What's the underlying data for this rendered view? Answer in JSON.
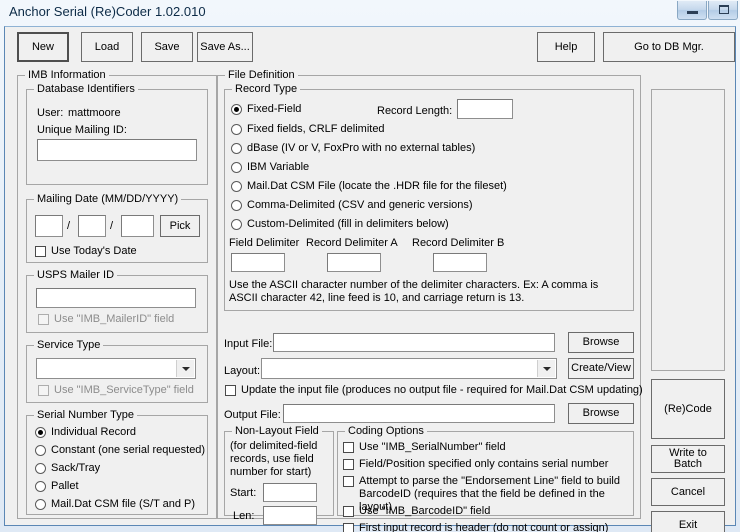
{
  "window": {
    "title": "Anchor Serial (Re)Coder 1.02.010",
    "minimize_label": "Minimize",
    "maximize_label": "Maximize"
  },
  "toolbar": {
    "new_label": "New",
    "load_label": "Load",
    "save_label": "Save",
    "save_as_label": "Save As...",
    "help_label": "Help",
    "db_mgr_label": "Go to DB Mgr."
  },
  "imb": {
    "legend": "IMB Information",
    "database_identifiers": {
      "legend": "Database Identifiers",
      "user_label": "User:",
      "user_value": "mattmoore",
      "unique_mailing_id_label": "Unique Mailing ID:",
      "unique_mailing_id_value": ""
    },
    "mailing_date": {
      "legend": "Mailing Date (MM/DD/YYYY)",
      "month_value": "",
      "day_value": "",
      "year_value": "",
      "sep1": "/",
      "sep2": "/",
      "pick_label": "Pick",
      "today_label": "Use Today's Date",
      "today_checked": false
    },
    "mailer_id": {
      "legend": "USPS Mailer ID",
      "value": "",
      "use_field_label": "Use \"IMB_MailerID\" field",
      "use_field_checked": false,
      "use_field_disabled": true
    },
    "service_type": {
      "legend": "Service Type",
      "selected": "",
      "use_field_label": "Use \"IMB_ServiceType\" field",
      "use_field_checked": false,
      "use_field_disabled": true
    },
    "serial_number_type": {
      "legend": "Serial Number Type",
      "options": [
        "Individual Record",
        "Constant (one serial requested)",
        "Sack/Tray",
        "Pallet",
        "Mail.Dat CSM file (S/T and P)"
      ],
      "selected_index": 0
    }
  },
  "file_definition": {
    "legend": "File Definition",
    "record_type": {
      "legend": "Record Type",
      "options": [
        "Fixed-Field",
        "Fixed fields, CRLF delimited",
        "dBase (IV or V, FoxPro with no external tables)",
        "IBM Variable",
        "Mail.Dat CSM File (locate the .HDR file for the fileset)",
        "Comma-Delimited (CSV and generic versions)",
        "Custom-Delimited (fill in delimiters below)"
      ],
      "selected_index": 0,
      "record_length_label": "Record Length:",
      "record_length_value": "",
      "field_delimiter_label": "Field Delimiter",
      "field_delimiter_value": "",
      "record_delimiter_a_label": "Record Delimiter A",
      "record_delimiter_a_value": "",
      "record_delimiter_b_label": "Record Delimiter B",
      "record_delimiter_b_value": "",
      "ascii_help": "Use the ASCII character number of the delimiter characters. Ex: A comma is ASCII character 42, line feed is 10, and carriage return is 13."
    },
    "input_file_label": "Input File:",
    "input_file_value": "",
    "input_browse_label": "Browse",
    "layout_label": "Layout:",
    "layout_selected": "",
    "create_view_label": "Create/View",
    "update_input_label": "Update the input file (produces no output file - required for Mail.Dat CSM updating)",
    "update_input_checked": false,
    "output_file_label": "Output File:",
    "output_file_value": "",
    "output_browse_label": "Browse",
    "non_layout_field": {
      "legend": "Non-Layout Field",
      "note": "(for delimited-field records, use field number for start)",
      "start_label": "Start:",
      "start_value": "",
      "len_label": "Len:",
      "len_value": ""
    },
    "coding_options": {
      "legend": "Coding Options",
      "options": [
        {
          "label": "Use \"IMB_SerialNumber\" field",
          "checked": false
        },
        {
          "label": "Field/Position specified only contains serial number",
          "checked": false
        },
        {
          "label": "Attempt to parse the \"Endorsement Line\" field to build BarcodeID (requires that the field be defined in the layout)",
          "checked": false
        },
        {
          "label": "Use \"IMB_BarcodeID\" field",
          "checked": false
        },
        {
          "label": "First input record is header (do not count or assign)",
          "checked": false
        }
      ]
    }
  },
  "actions": {
    "recode_label": "(Re)Code",
    "write_batch_label": "Write to Batch",
    "cancel_label": "Cancel",
    "exit_label": "Exit"
  },
  "colors": {
    "titlebar_text": "#0d2b47",
    "window_border": "#5b87b5",
    "dialog_face": "#f0f0f0",
    "groupbox_border": "#a6a6a6",
    "disabled_text": "#8c8c8c"
  }
}
